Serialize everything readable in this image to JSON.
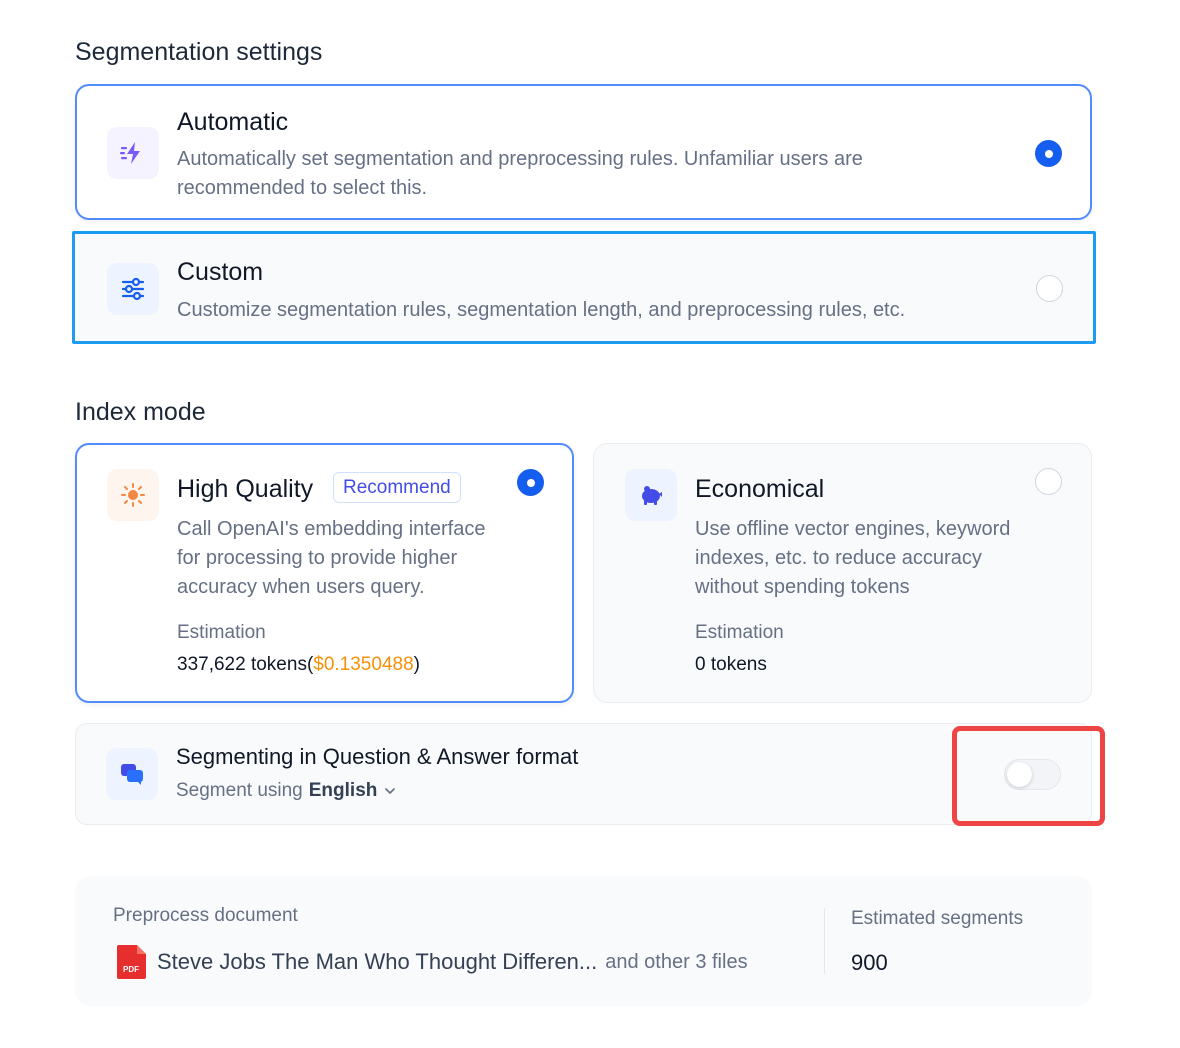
{
  "segmentation": {
    "title": "Segmentation settings",
    "automatic": {
      "title": "Automatic",
      "description_line1": "Automatically set segmentation and preprocessing rules. Unfamiliar users are",
      "description_line2": "recommended to select this.",
      "icon": "lightning-icon",
      "selected": true
    },
    "custom": {
      "title": "Custom",
      "description": "Customize segmentation rules, segmentation length, and preprocessing rules, etc.",
      "icon": "sliders-icon",
      "selected": false
    }
  },
  "index_mode": {
    "title": "Index mode",
    "high_quality": {
      "title": "High Quality",
      "badge": "Recommend",
      "description_line1": "Call OpenAI's embedding interface",
      "description_line2": "for processing to provide higher",
      "description_line3": "accuracy when users query.",
      "estimation_label": "Estimation",
      "tokens": "337,622 tokens(",
      "price": "$0.1350488",
      "close_paren": ")",
      "icon": "sparkle-icon",
      "selected": true
    },
    "economical": {
      "title": "Economical",
      "description_line1": "Use offline vector engines, keyword",
      "description_line2": "indexes, etc. to reduce accuracy",
      "description_line3": "without spending tokens",
      "estimation_label": "Estimation",
      "tokens": "0 tokens",
      "icon": "piggy-bank-icon",
      "selected": false
    }
  },
  "qa_format": {
    "title": "Segmenting in Question & Answer format",
    "segment_using": "Segment using",
    "language": "English",
    "enabled": false,
    "icon": "chat-bubbles-icon"
  },
  "preprocess": {
    "label": "Preprocess document",
    "file_name": "Steve Jobs The Man Who Thought Differen...",
    "more_files": "and other 3 files",
    "file_icon_text": "PDF",
    "segments_label": "Estimated segments",
    "segments_value": "900"
  },
  "colors": {
    "primary": "#155eef",
    "price": "#f79009",
    "highlight": "#ef4444",
    "custom_border": "#1d9bf0"
  }
}
